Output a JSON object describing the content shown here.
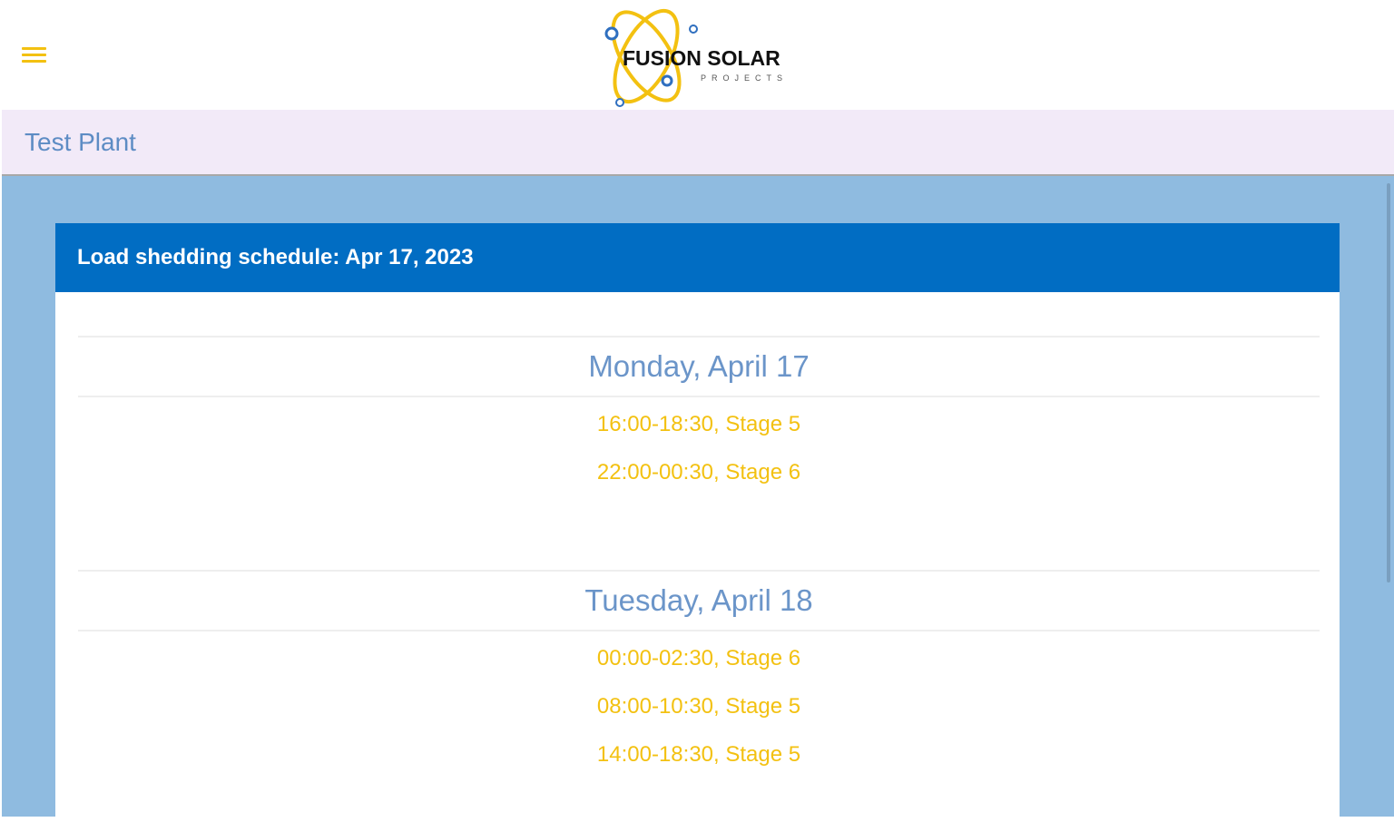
{
  "header": {
    "menu_icon": "hamburger-menu-icon",
    "logo_text": "FUSION SOLAR",
    "logo_subtext": "PROJECTS",
    "accent_color": "#f3c111"
  },
  "plant": {
    "name": "Test Plant"
  },
  "schedule": {
    "title": "Load shedding schedule: Apr 17, 2023",
    "days": [
      {
        "label": "Monday, April 17",
        "slots": [
          "16:00-18:30, Stage 5",
          "22:00-00:30, Stage 6"
        ]
      },
      {
        "label": "Tuesday, April 18",
        "slots": [
          "00:00-02:30, Stage 6",
          "08:00-10:30, Stage 5",
          "14:00-18:30, Stage 5"
        ]
      }
    ]
  }
}
